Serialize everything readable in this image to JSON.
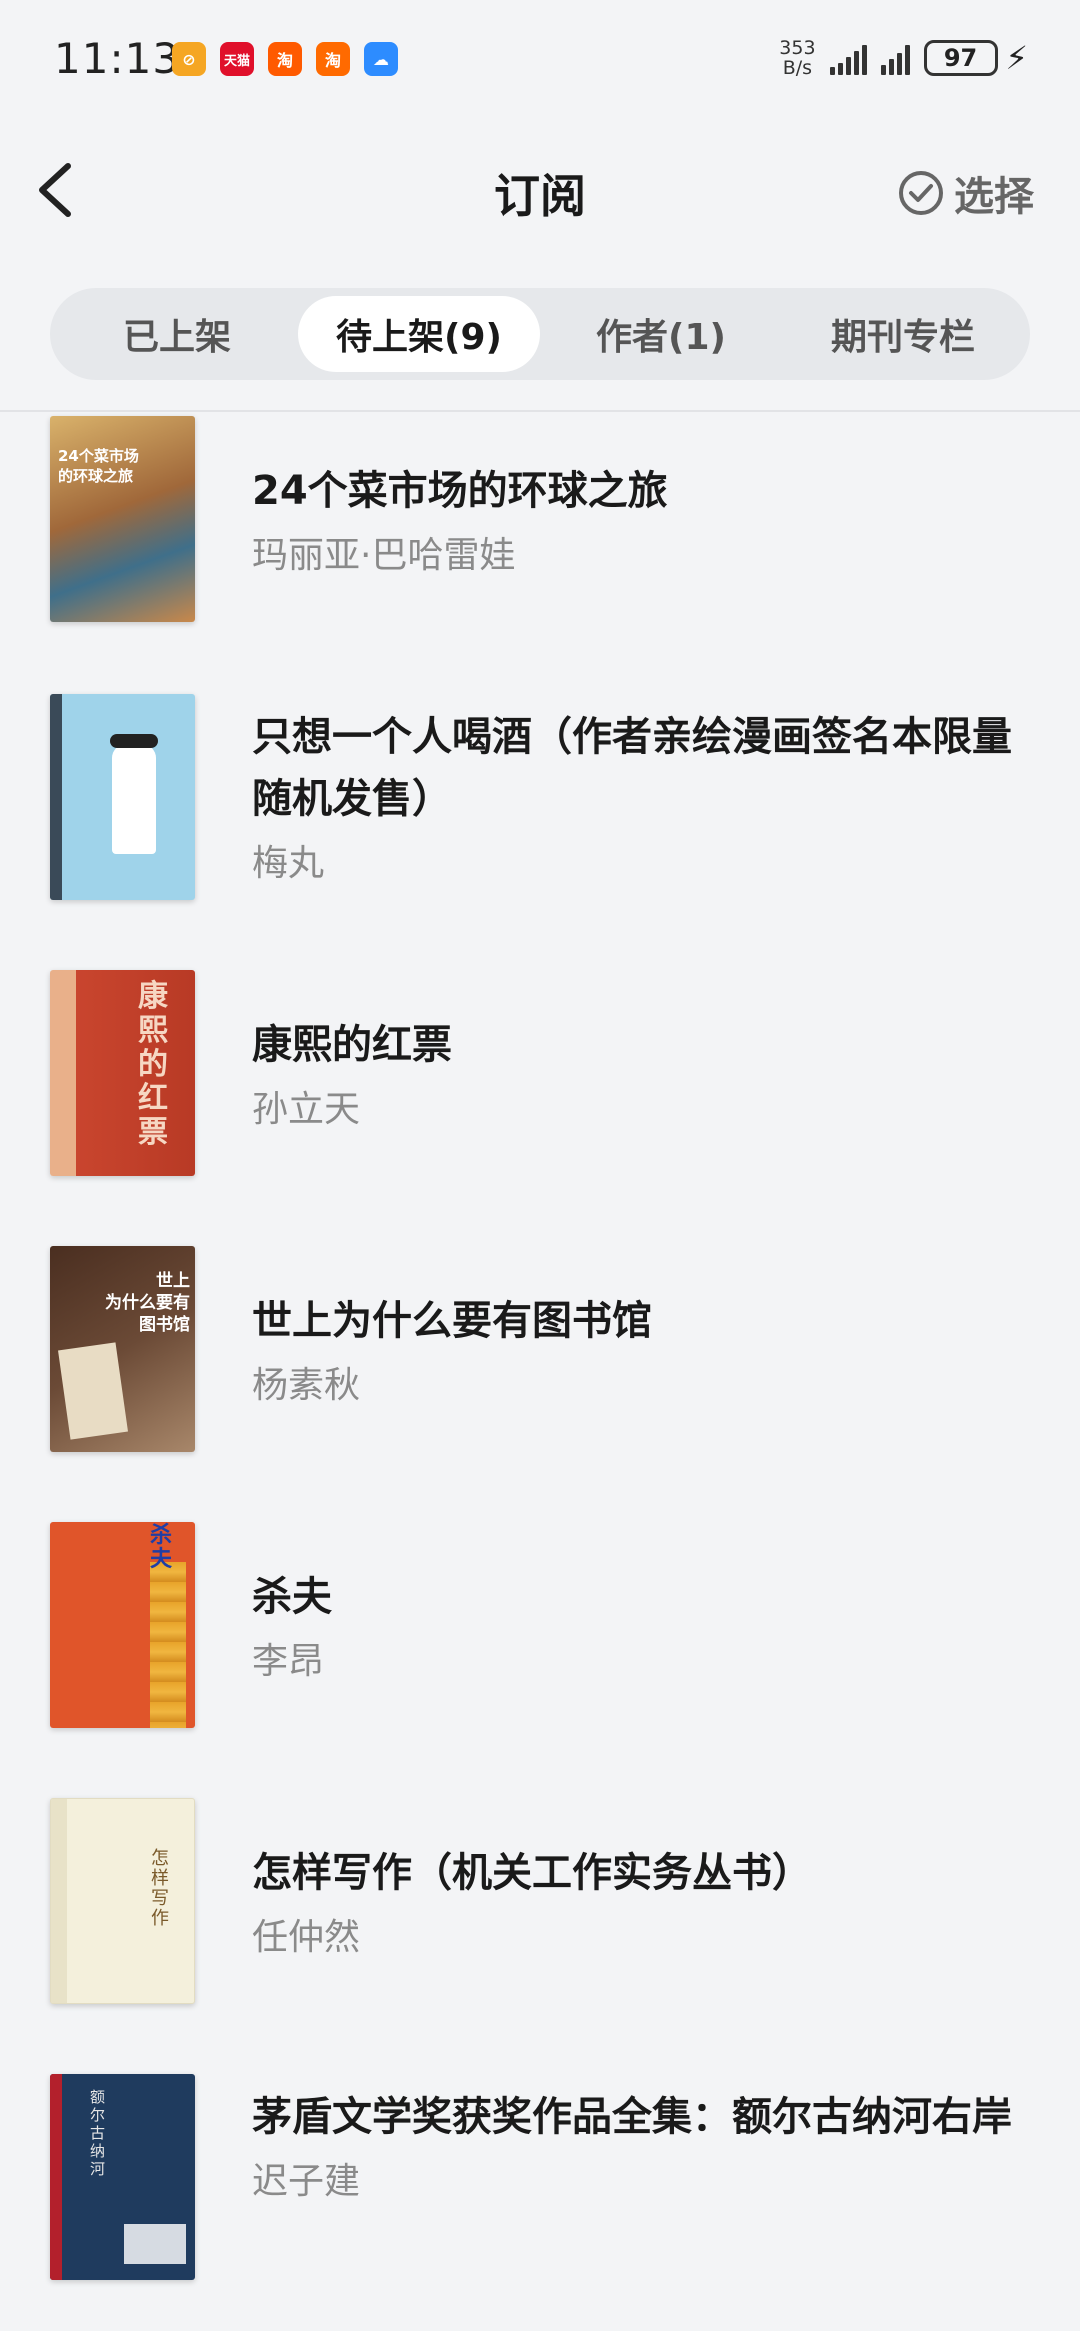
{
  "status_bar": {
    "time": "11:13",
    "net_speed_value": "353",
    "net_speed_unit": "B/s",
    "battery": "97",
    "app_icons": [
      {
        "name": "app-icon-orange",
        "label": "",
        "color": "#f5a623"
      },
      {
        "name": "app-icon-tmall",
        "label": "天猫",
        "color": "#e0102b"
      },
      {
        "name": "app-icon-taobao",
        "label": "淘",
        "color": "#ff5a00"
      },
      {
        "name": "app-icon-taobao-xianyu",
        "label": "淘",
        "color": "#ff6a00"
      },
      {
        "name": "app-icon-weather",
        "label": "",
        "color": "#2d8cff"
      }
    ]
  },
  "header": {
    "title": "订阅",
    "select_label": "选择"
  },
  "tabs": [
    {
      "label": "已上架",
      "active": false
    },
    {
      "label": "待上架(9)",
      "active": true
    },
    {
      "label": "作者(1)",
      "active": false
    },
    {
      "label": "期刊专栏",
      "active": false
    }
  ],
  "books": [
    {
      "title": "24个菜市场的环球之旅",
      "author": "玛丽亚·巴哈雷娃",
      "cover_color": "#c89b5a"
    },
    {
      "title": "只想一个人喝酒（作者亲绘漫画签名本限量随机发售）",
      "author": "梅丸",
      "cover_color": "#9fd3ea"
    },
    {
      "title": "康熙的红票",
      "author": "孙立天",
      "cover_color": "#c9452e"
    },
    {
      "title": "世上为什么要有图书馆",
      "author": "杨素秋",
      "cover_color": "#5a3a2a"
    },
    {
      "title": "杀夫",
      "author": "李昂",
      "cover_color": "#e0552a"
    },
    {
      "title": "怎样写作（机关工作实务丛书）",
      "author": "任仲然",
      "cover_color": "#f4f0dc"
    },
    {
      "title": "茅盾文学奖获奖作品全集：额尔古纳河右岸",
      "author": "迟子建",
      "cover_color": "#1f3b5e"
    }
  ],
  "colors": {
    "background": "#f3f4f6",
    "tab_bg": "#e6e8eb",
    "active_tab": "#ffffff",
    "author_gray": "#8a8a8a"
  }
}
